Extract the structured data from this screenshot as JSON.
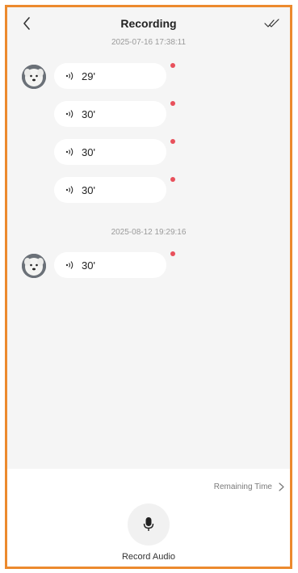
{
  "header": {
    "title": "Recording",
    "back_icon": "chevron-left-icon",
    "read_all_icon": "double-check-icon"
  },
  "groups": [
    {
      "timestamp": "2025-07-16 17:38:11",
      "messages": [
        {
          "duration": "29'",
          "unread": true
        },
        {
          "duration": "30'",
          "unread": true
        },
        {
          "duration": "30'",
          "unread": true
        },
        {
          "duration": "30'",
          "unread": true
        }
      ]
    },
    {
      "timestamp": "2025-08-12 19:29:16",
      "messages": [
        {
          "duration": "30'",
          "unread": true
        }
      ]
    }
  ],
  "footer": {
    "remaining_time_label": "Remaining Time",
    "record_label": "Record Audio",
    "mic_icon": "microphone-icon"
  },
  "colors": {
    "frame_border": "#ec8a2e",
    "unread_dot": "#e8505b",
    "background": "#f5f5f5"
  }
}
